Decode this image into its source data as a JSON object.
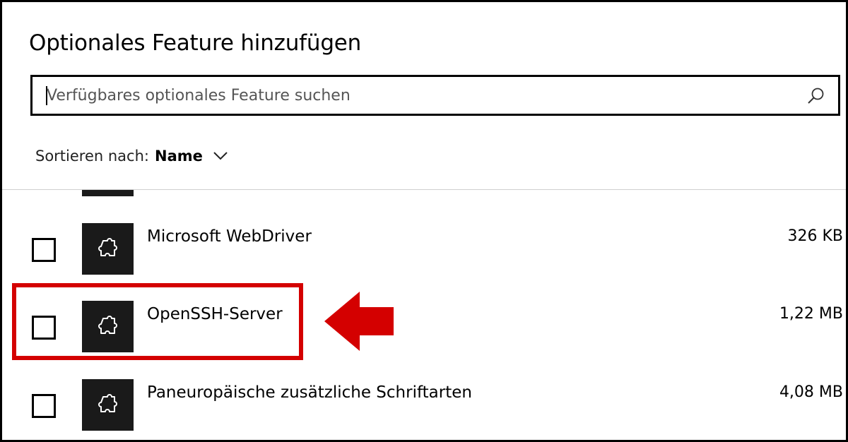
{
  "dialog": {
    "title": "Optionales Feature hinzufügen"
  },
  "search": {
    "placeholder": "Verfügbares optionales Feature suchen",
    "value": "",
    "icon": "search-icon"
  },
  "sort": {
    "label": "Sortieren nach:",
    "value": "Name"
  },
  "features": [
    {
      "name": "Microsoft WebDriver",
      "size": "326 KB",
      "checked": false,
      "icon": "puzzle-icon"
    },
    {
      "name": "OpenSSH-Server",
      "size": "1,22 MB",
      "checked": false,
      "icon": "puzzle-icon",
      "highlighted": true
    },
    {
      "name": "Paneuropäische zusätzliche Schriftarten",
      "size": "4,08 MB",
      "checked": false,
      "icon": "puzzle-icon"
    }
  ],
  "colors": {
    "highlight": "#d40000",
    "icon_bg": "#1a1a1a"
  }
}
